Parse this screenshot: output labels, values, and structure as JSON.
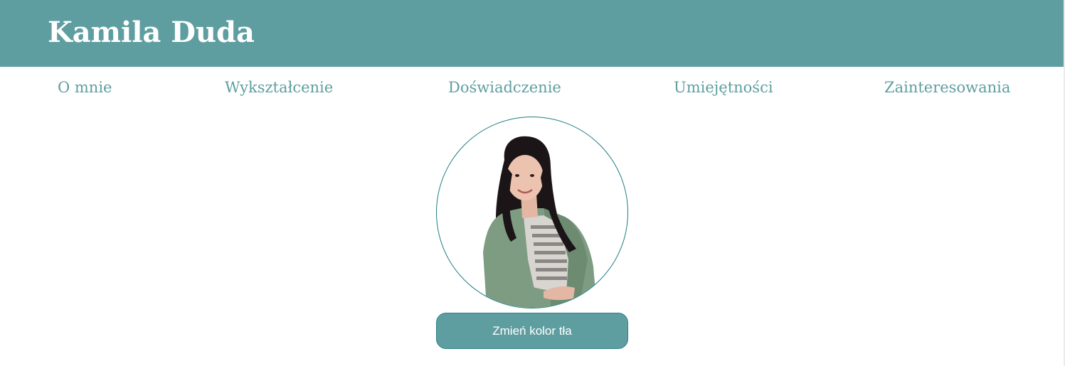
{
  "header": {
    "title": "Kamila Duda"
  },
  "nav": {
    "items": [
      {
        "label": "O mnie"
      },
      {
        "label": "Wykształcenie"
      },
      {
        "label": "Doświadczenie"
      },
      {
        "label": "Umiejętności"
      },
      {
        "label": "Zainteresowania"
      }
    ]
  },
  "profile": {
    "photo_alt": "Kamila Duda"
  },
  "actions": {
    "change_bg_label": "Zmień kolor tła"
  },
  "colors": {
    "accent": "#5f9ea0",
    "photo_border": "#1f7d80",
    "background": "#ffffff",
    "text_on_accent": "#ffffff"
  }
}
